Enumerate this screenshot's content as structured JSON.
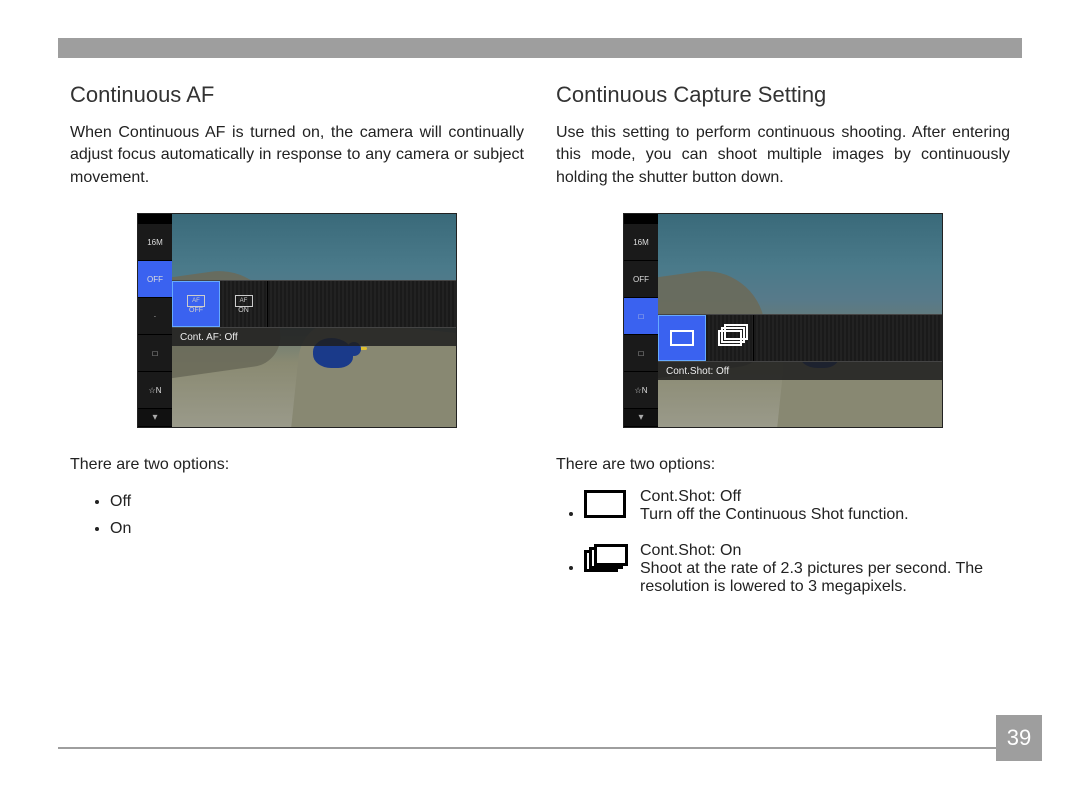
{
  "page_number": "39",
  "left": {
    "heading": "Continuous AF",
    "intro": "When Continuous AF is turned on, the camera will continually adjust focus automatically in response to any camera or subject movement.",
    "ribbon_caption": "Cont. AF: Off",
    "sidebar_icons": [
      "16M",
      "OFF",
      "·",
      "□",
      "☆N"
    ],
    "options_intro": "There are two options:",
    "options": [
      "Off",
      "On"
    ]
  },
  "right": {
    "heading": "Continuous Capture Setting",
    "intro": "Use this setting to perform continuous shooting. After entering this mode, you can shoot multiple images by continuously holding the shutter button down.",
    "ribbon_caption": "Cont.Shot: Off",
    "sidebar_icons": [
      "16M",
      "OFF",
      "□",
      "□",
      "☆N"
    ],
    "options_intro": "There are two options:",
    "options": [
      {
        "icon": "single",
        "title": "Cont.Shot: Off",
        "desc": "Turn off the Continuous Shot function."
      },
      {
        "icon": "multi",
        "title": "Cont.Shot: On",
        "desc": "Shoot at the rate of 2.3 pictures per second. The resolution is lowered to 3 megapixels."
      }
    ]
  }
}
